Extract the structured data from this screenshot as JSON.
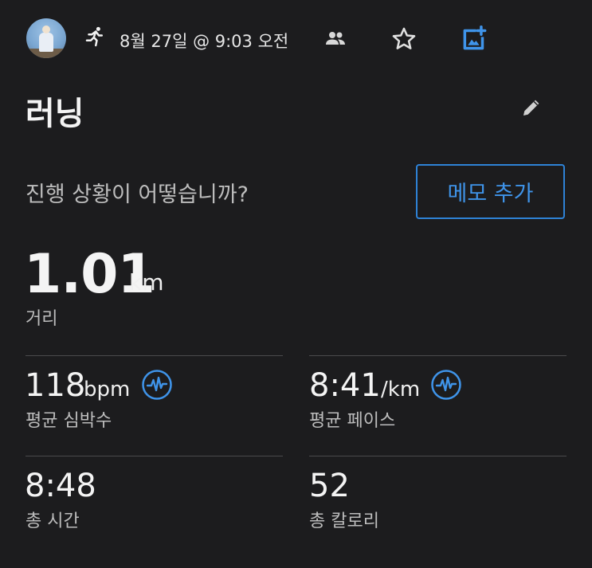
{
  "header": {
    "datetime": "8월 27일 @ 9:03 오전",
    "icons": [
      "avatar",
      "running-icon",
      "people-icon",
      "star-icon",
      "add-photo-icon"
    ],
    "accent_color": "#3f94ea"
  },
  "activity": {
    "title": "러닝",
    "prompt": "진행 상황이 어떻습니까?",
    "memo_button": "메모 추가"
  },
  "distance": {
    "value": "1.01",
    "unit": "km",
    "label": "거리"
  },
  "stats": {
    "heart_rate": {
      "value": "118",
      "unit": "bpm",
      "label": "평균 심박수"
    },
    "pace": {
      "value": "8:41",
      "unit": "/km",
      "label": "평균 페이스"
    },
    "time": {
      "value": "8:48",
      "label": "총 시간"
    },
    "calories": {
      "value": "52",
      "label": "총 칼로리"
    }
  }
}
